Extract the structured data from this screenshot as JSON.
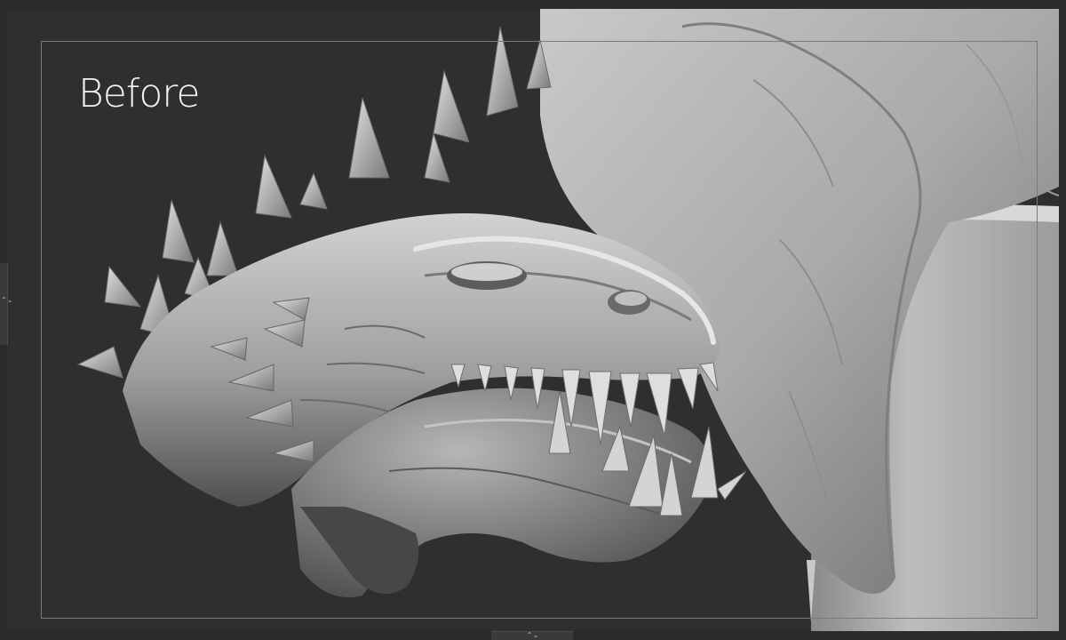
{
  "viewport": {
    "label": "Before"
  },
  "handles": {
    "left_glyph": "⌃⌄",
    "bottom_glyph": "⌃⌄"
  }
}
